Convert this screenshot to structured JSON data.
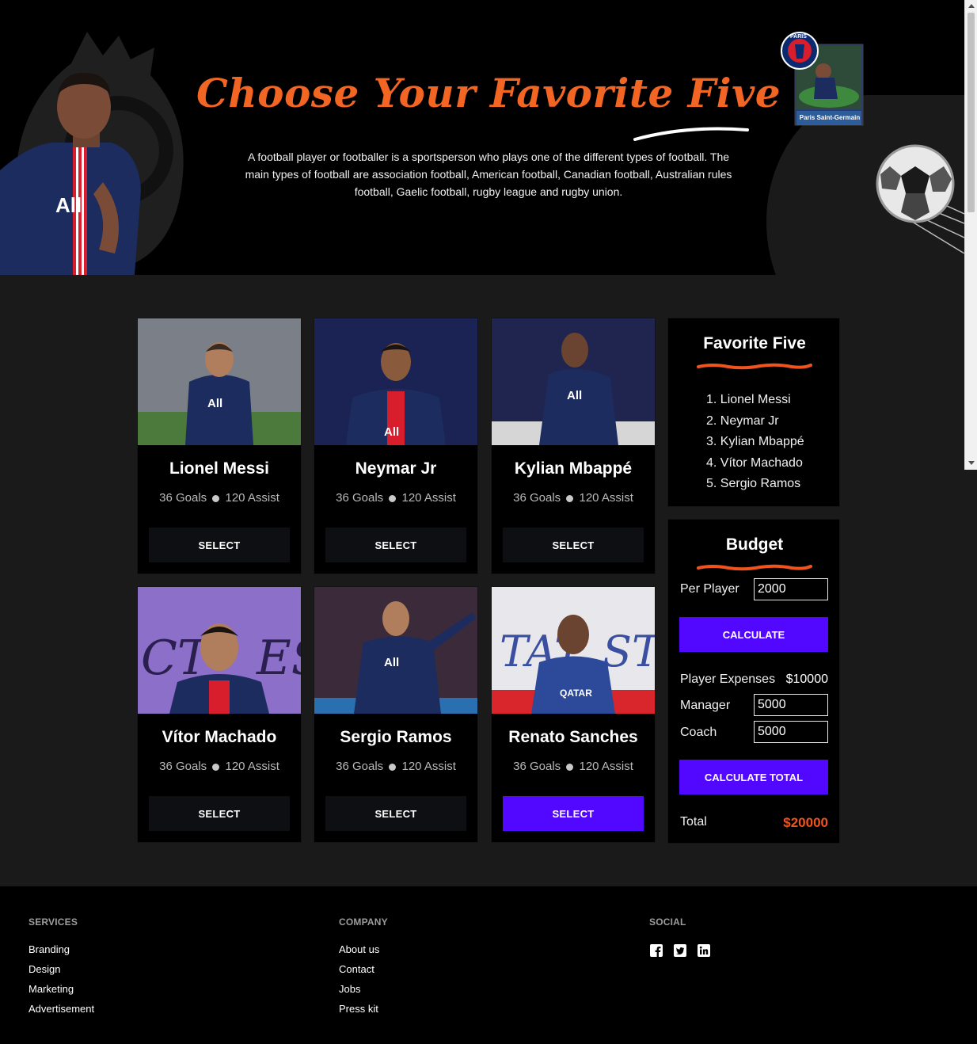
{
  "hero": {
    "title": "Choose Your Favorite Five",
    "description": "A football player or footballer is a sportsperson who plays one of the different types of football. The main types of football are association football, American football, Canadian football, Australian rules football, Gaelic football, rugby league and rugby union.",
    "badge_text": "Paris Saint-Germain",
    "badge_crest": "PARIS"
  },
  "players": [
    {
      "name": "Lionel Messi",
      "goals": "36 Goals",
      "assist": "120 Assist",
      "select_label": "SELECT"
    },
    {
      "name": "Neymar Jr",
      "goals": "36 Goals",
      "assist": "120 Assist",
      "select_label": "SELECT"
    },
    {
      "name": "Kylian Mbappé",
      "goals": "36 Goals",
      "assist": "120 Assist",
      "select_label": "SELECT"
    },
    {
      "name": "Vítor Machado",
      "goals": "36 Goals",
      "assist": "120 Assist",
      "select_label": "SELECT"
    },
    {
      "name": "Sergio Ramos",
      "goals": "36 Goals",
      "assist": "120 Assist",
      "select_label": "SELECT"
    },
    {
      "name": "Renato Sanches",
      "goals": "36 Goals",
      "assist": "120 Assist",
      "select_label": "SELECT"
    }
  ],
  "favorites": {
    "title": "Favorite Five",
    "items": [
      "1. Lionel Messi",
      "2. Neymar Jr",
      "3. Kylian Mbappé",
      "4. Vítor Machado",
      "5. Sergio Ramos"
    ]
  },
  "budget": {
    "title": "Budget",
    "per_player_label": "Per Player",
    "per_player_value": "2000",
    "calculate_label": "CALCULATE",
    "player_expenses_label": "Player Expenses",
    "player_expenses_value": "$10000",
    "manager_label": "Manager",
    "manager_value": "5000",
    "coach_label": "Coach",
    "coach_value": "5000",
    "calculate_total_label": "CALCULATE TOTAL",
    "total_label": "Total",
    "total_value": "$20000"
  },
  "footer": {
    "services": {
      "heading": "SERVICES",
      "links": [
        "Branding",
        "Design",
        "Marketing",
        "Advertisement"
      ]
    },
    "company": {
      "heading": "COMPANY",
      "links": [
        "About us",
        "Contact",
        "Jobs",
        "Press kit"
      ]
    },
    "social": {
      "heading": "SOCIAL",
      "icons": [
        "facebook-icon",
        "twitter-icon",
        "linkedin-icon"
      ]
    }
  },
  "colors": {
    "accent_orange": "#f26522",
    "accent_purple": "#5208ff",
    "total_red": "#f0541e",
    "psg_navy": "#1a2a5c"
  }
}
